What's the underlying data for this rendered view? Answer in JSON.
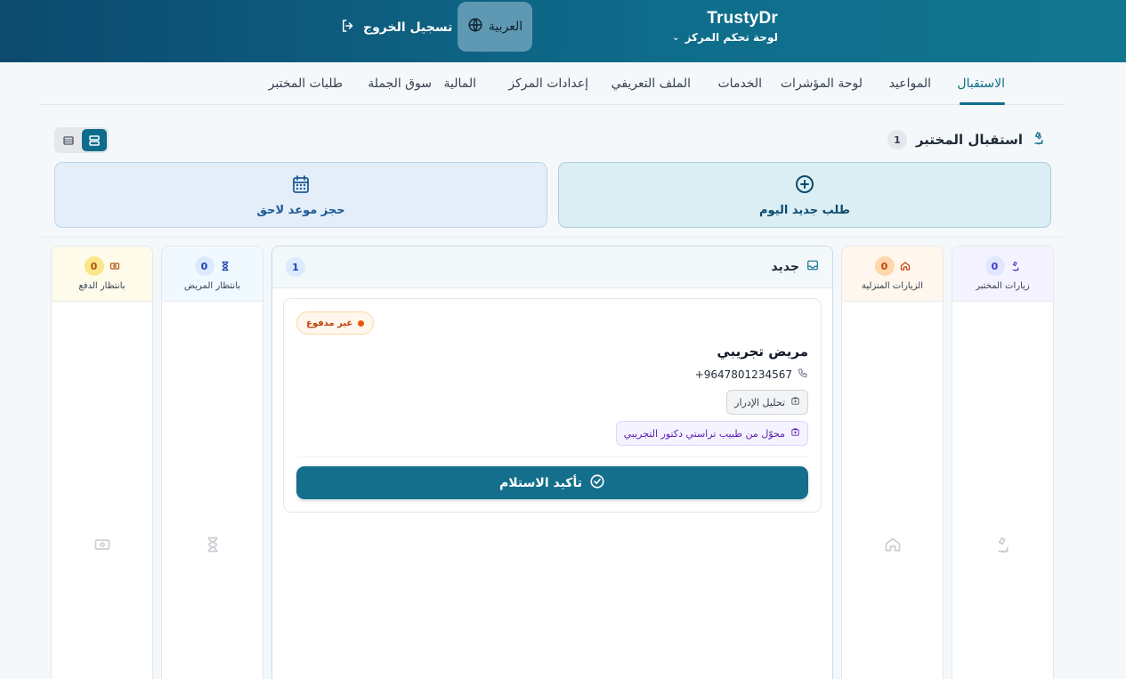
{
  "header": {
    "brand": "TrustyDr",
    "subtitle": "لوحة تحكم المركز",
    "language": "العربية",
    "logout": "تسجيل الخروج"
  },
  "tabs": [
    {
      "label": "الاستقبال",
      "active": true
    },
    {
      "label": "المواعيد"
    },
    {
      "label": "لوحة المؤشرات"
    },
    {
      "label": "الخدمات"
    },
    {
      "label": "الملف التعريفي"
    },
    {
      "label": "إعدادات المركز"
    },
    {
      "label": "المالية"
    },
    {
      "label": "سوق الجملة"
    },
    {
      "label": "طلبات المختبر"
    }
  ],
  "section": {
    "title": "استقبال المختبر",
    "count": "1"
  },
  "actions": {
    "new_today": "طلب جديد اليوم",
    "book_later": "حجز موعد لاحق"
  },
  "columns": {
    "lab_visits": {
      "label": "زيارات المختبر",
      "count": "0"
    },
    "home_visits": {
      "label": "الزيارات المنزلية",
      "count": "0"
    },
    "new": {
      "label": "جديد",
      "count": "1"
    },
    "waiting_patient": {
      "label": "بانتظار المريض",
      "count": "0"
    },
    "waiting_payment": {
      "label": "بانتظار الدفع",
      "count": "0"
    }
  },
  "card": {
    "payment_status": "غير مدفوع",
    "patient_name": "مريض تجريبي",
    "phone": "+9647801234567",
    "test": "تحليل الإدرار",
    "referral": "محوّل من طبيب تراستي دكتور التجريبي",
    "confirm": "تأكيد الاستلام"
  },
  "colors": {
    "header": "#0f6d8c",
    "accent": "#146f8c",
    "unpaid": "#ea580c"
  }
}
